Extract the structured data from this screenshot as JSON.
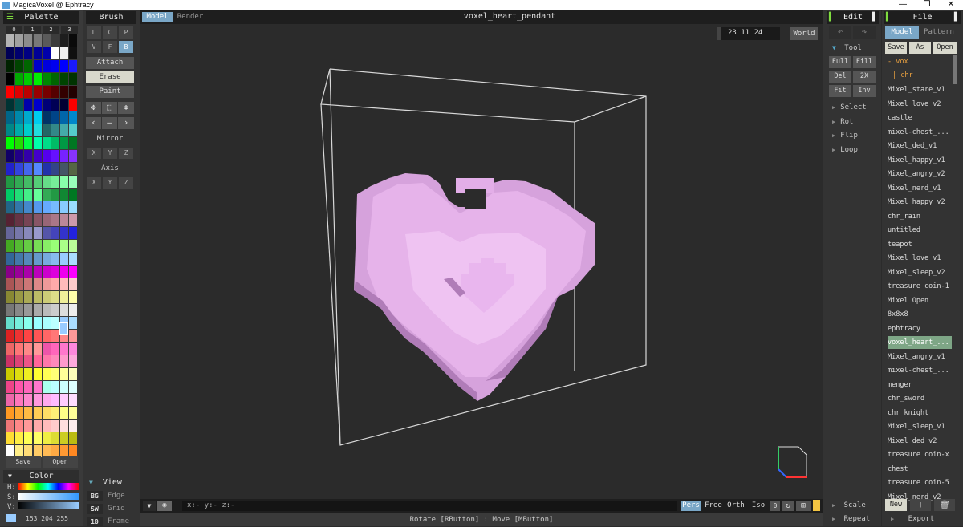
{
  "window": {
    "title": "MagicaVoxel @ Ephtracy",
    "minimize": "—",
    "maximize": "❐",
    "close": "✕"
  },
  "palette": {
    "header": "Palette",
    "tabs": [
      "0",
      "1",
      "2",
      "3"
    ],
    "save_label": "Save",
    "open_label": "Open",
    "colors": [
      [
        "#b4b4b4",
        "#a0a0a0",
        "#8c8c8c",
        "#787878",
        "#5a5a5a",
        "#3c3c3c",
        "#1e1e1e",
        "#0a0a0a"
      ],
      [
        "#000055",
        "#00006e",
        "#000082",
        "#000096",
        "#0000aa",
        "#ffffff",
        "#f0f0f0",
        "#101010"
      ],
      [
        "#002200",
        "#004400",
        "#006600",
        "#0000cc",
        "#0000dd",
        "#0000ee",
        "#0000ff",
        "#1a1aff"
      ],
      [
        "#000000",
        "#00aa00",
        "#00cc00",
        "#00ee00",
        "#008800",
        "#006600",
        "#004400",
        "#003300"
      ],
      [
        "#ff0000",
        "#dd0000",
        "#bb0000",
        "#990000",
        "#770000",
        "#550000",
        "#330000",
        "#220000"
      ],
      [
        "#003333",
        "#005555",
        "#0000aa",
        "#0000cc",
        "#000077",
        "#000055",
        "#000033",
        "#ff0000"
      ],
      [
        "#006688",
        "#0088aa",
        "#00aacc",
        "#00ccee",
        "#003366",
        "#004488",
        "#0066aa",
        "#0088cc"
      ],
      [
        "#008888",
        "#00aaaa",
        "#00cccc",
        "#22dddd",
        "#226666",
        "#338888",
        "#44aaaa",
        "#55cccc"
      ],
      [
        "#00ff00",
        "#22dd00",
        "#00ff44",
        "#00ffaa",
        "#00dd88",
        "#00bb66",
        "#009944",
        "#007722"
      ],
      [
        "#110066",
        "#220088",
        "#3300aa",
        "#4400cc",
        "#5500ee",
        "#6611ff",
        "#7722ff",
        "#8833ff"
      ],
      [
        "#2222cc",
        "#3344dd",
        "#4466ee",
        "#5588ff",
        "#2233aa",
        "#334488",
        "#445566",
        "#556644"
      ],
      [
        "#229944",
        "#33aa55",
        "#44bb66",
        "#55cc77",
        "#66dd88",
        "#77ee99",
        "#88ffaa",
        "#99ffbb"
      ],
      [
        "#00cc66",
        "#22dd77",
        "#44ee88",
        "#66ff99",
        "#33aa55",
        "#229944",
        "#118833",
        "#007722"
      ],
      [
        "#226688",
        "#3377aa",
        "#4488cc",
        "#5599ee",
        "#66aaff",
        "#77bbff",
        "#88ccff",
        "#99ddff"
      ],
      [
        "#552233",
        "#663344",
        "#774455",
        "#885566",
        "#996677",
        "#aa7788",
        "#bb8899",
        "#cc99aa"
      ],
      [
        "#666699",
        "#7777aa",
        "#8888bb",
        "#9999cc",
        "#5555aa",
        "#4444bb",
        "#3333cc",
        "#2222dd"
      ],
      [
        "#44aa22",
        "#55bb33",
        "#66cc44",
        "#77dd55",
        "#88ee66",
        "#99ff77",
        "#aaff88",
        "#bbff99"
      ],
      [
        "#336699",
        "#4477aa",
        "#5588bb",
        "#6699cc",
        "#77aadd",
        "#88bbee",
        "#99ccff",
        "#aaddff"
      ],
      [
        "#880088",
        "#990099",
        "#aa00aa",
        "#bb00bb",
        "#cc00cc",
        "#dd00dd",
        "#ee00ee",
        "#ff00ff"
      ],
      [
        "#aa5555",
        "#bb6666",
        "#cc7777",
        "#dd8888",
        "#ee9999",
        "#ffaaaa",
        "#ffbbbb",
        "#ffcccc"
      ],
      [
        "#888833",
        "#999944",
        "#aaaa55",
        "#bbbb66",
        "#cccc77",
        "#dddd88",
        "#eeee99",
        "#ffffaa"
      ],
      [
        "#777777",
        "#888888",
        "#999999",
        "#aaaaaa",
        "#bbbbbb",
        "#cccccc",
        "#dddddd",
        "#eeeeee"
      ],
      [
        "#66ddcc",
        "#77eedd",
        "#88ffee",
        "#99ffff",
        "#aaffff",
        "#bbffff",
        "#99ccff",
        "#aaddff"
      ],
      [
        "#dd2222",
        "#ee3333",
        "#ff4444",
        "#ff5555",
        "#ff6666",
        "#ff7777",
        "#ff8888",
        "#ff9999"
      ],
      [
        "#ee6666",
        "#ff7777",
        "#ff8888",
        "#ff9999",
        "#ee55aa",
        "#ff66bb",
        "#ff77cc",
        "#ff88dd"
      ],
      [
        "#cc3366",
        "#dd4477",
        "#ee5588",
        "#ff6699",
        "#ff77aa",
        "#ff88bb",
        "#ff99cc",
        "#ffaadd"
      ],
      [
        "#cccc00",
        "#dddd11",
        "#eeee22",
        "#ffff33",
        "#ffff55",
        "#ffff77",
        "#ffff99",
        "#ffffbb"
      ],
      [
        "#ee4488",
        "#ff55aa",
        "#ff66bb",
        "#ff77cc",
        "#aaffee",
        "#bbffff",
        "#ccffff",
        "#ddffff"
      ],
      [
        "#ee66aa",
        "#ff77bb",
        "#ff88cc",
        "#ff99dd",
        "#ffaaee",
        "#ffbbff",
        "#ffccff",
        "#ffddff"
      ],
      [
        "#ff9922",
        "#ffaa33",
        "#ffbb44",
        "#ffcc55",
        "#ffdd66",
        "#ffee77",
        "#ffff88",
        "#ffff99"
      ],
      [
        "#ee7777",
        "#ff8888",
        "#ff9999",
        "#ffaaaa",
        "#ffbbbb",
        "#ffcccc",
        "#ffdddd",
        "#ffeeee"
      ],
      [
        "#ffdd33",
        "#ffee44",
        "#ffff55",
        "#ffff66",
        "#eeee44",
        "#dddd33",
        "#cccc22",
        "#bbbb11"
      ],
      [
        "#ffffff",
        "#ffee88",
        "#ffdd77",
        "#ffcc66",
        "#ffbb55",
        "#ffaa44",
        "#ff9933",
        "#ff8822"
      ]
    ]
  },
  "color": {
    "header": "Color",
    "h_label": "H:",
    "s_label": "S:",
    "v_label": "V:",
    "rgb": "153 204 255",
    "current": "#99ccff"
  },
  "brush": {
    "header": "Brush",
    "mode_row1": [
      "L",
      "C",
      "P"
    ],
    "mode_row2": [
      "V",
      "F",
      "B"
    ],
    "attach": "Attach",
    "erase": "Erase",
    "paint": "Paint",
    "mirror_label": "Mirror",
    "axis_label": "Axis",
    "xyz": [
      "X",
      "Y",
      "Z"
    ]
  },
  "view": {
    "header": "View",
    "rows": [
      {
        "key": "BG",
        "label": "Edge"
      },
      {
        "key": "SW",
        "label": "Grid"
      },
      {
        "key": "10",
        "label": "Frame"
      }
    ]
  },
  "top": {
    "tab_model": "Model",
    "tab_render": "Render",
    "filename": "voxel_heart_pendant",
    "dims": "23  11  24",
    "world": "World"
  },
  "viewport": {
    "voxel_color": "#e6b3ea"
  },
  "bottom": {
    "coords": "x:-    y:-    z:-",
    "pers": "Pers",
    "free": "Free",
    "orth": "Orth",
    "iso": "Iso",
    "zero": "0",
    "status": "Rotate [RButton] : Move [MButton]"
  },
  "edit": {
    "header": "Edit",
    "tool_label": "Tool",
    "buttons": [
      [
        "Full",
        "Fill"
      ],
      [
        "Del",
        "2X"
      ],
      [
        "Fit",
        "Inv"
      ]
    ],
    "menu": [
      "Select",
      "Rot",
      "Flip",
      "Loop"
    ],
    "scale": "Scale",
    "repeat": "Repeat"
  },
  "file": {
    "header": "File",
    "tab_model": "Model",
    "tab_pattern": "Pattern",
    "save": "Save",
    "as": "As",
    "open": "Open",
    "folder_vox": "- vox",
    "folder_chr": "| chr",
    "items": [
      "Mixel_stare_v1",
      "Mixel_love_v2",
      "castle",
      "mixel-chest_...",
      "Mixel_ded_v1",
      "Mixel_happy_v1",
      "Mixel_angry_v2",
      "Mixel_nerd_v1",
      "Mixel_happy_v2",
      "chr_rain",
      "untitled",
      "teapot",
      "Mixel_love_v1",
      "Mixel_sleep_v2",
      "treasure coin-1",
      "Mixel Open",
      "8x8x8",
      "ephtracy",
      "voxel_heart_...",
      "Mixel_angry_v1",
      "mixel-chest_...",
      "menger",
      "chr_sword",
      "chr_knight",
      "Mixel_sleep_v1",
      "Mixel_ded_v2",
      "treasure coin-x",
      "chest",
      "treasure coin-5",
      "Mixel_nerd_v2"
    ],
    "selected": "voxel_heart_...",
    "new": "New",
    "export": "Export"
  }
}
